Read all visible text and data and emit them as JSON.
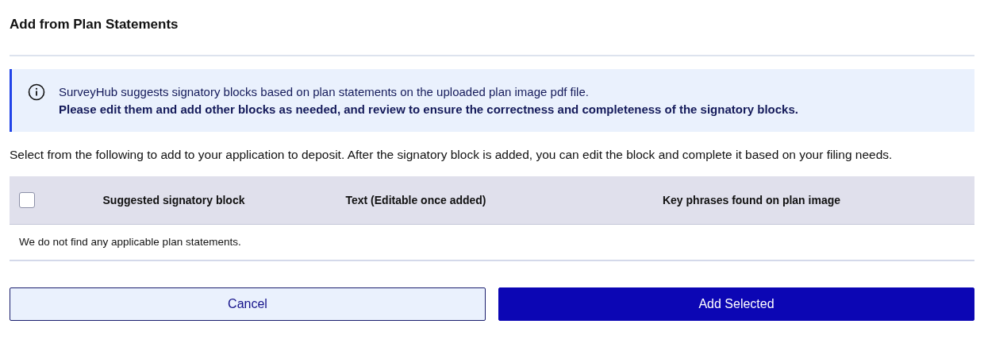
{
  "dialog": {
    "title": "Add from Plan Statements"
  },
  "info": {
    "message": "SurveyHub suggests signatory blocks based on plan statements on the uploaded plan image pdf file.",
    "emphasis": "Please edit them and add other blocks as needed, and review to ensure the correctness and completeness of the signatory blocks."
  },
  "instructions": "Select from the following to add to your application to deposit. After the signatory block is added, you can edit the block and complete it based on your filing needs.",
  "table": {
    "select_all": {
      "checked": false
    },
    "columns": [
      "Suggested signatory block",
      "Text (Editable once added)",
      "Key phrases found on plan image"
    ],
    "empty_message": "We do not find any applicable plan statements."
  },
  "buttons": [
    {
      "label": "Cancel",
      "kind": "secondary"
    },
    {
      "label": "Add Selected",
      "kind": "primary"
    }
  ]
}
